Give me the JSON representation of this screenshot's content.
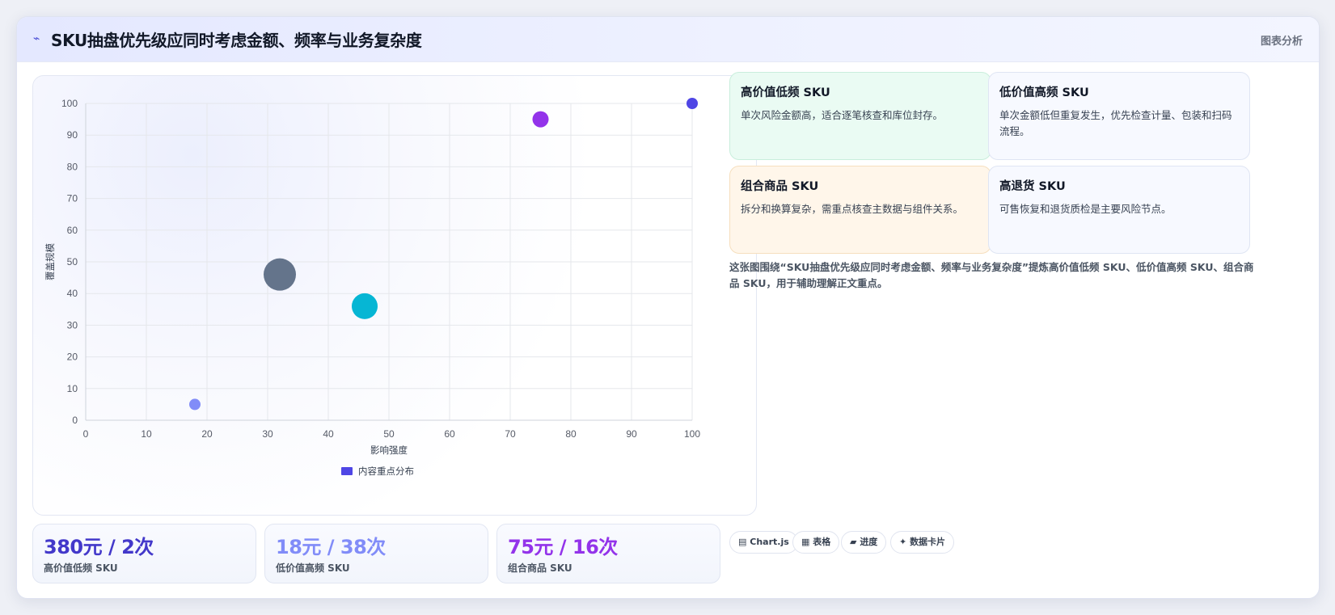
{
  "header": {
    "icon": "chart-icon",
    "title": "SKU抽盘优先级应同时考虑金额、频率与业务复杂度",
    "tag": "图表分析"
  },
  "colors": {
    "accent": "#4f46e5",
    "green_card": "#eafbf3",
    "orange_card": "#fff6ea",
    "blue_card": "#f7f9ff"
  },
  "chart_data": {
    "type": "bubble",
    "xlabel": "影响强度",
    "ylabel": "覆盖规模",
    "xlim": [
      0,
      100
    ],
    "ylim": [
      0,
      100
    ],
    "x_ticks": [
      0,
      10,
      20,
      30,
      40,
      50,
      60,
      70,
      80,
      90,
      100
    ],
    "y_ticks": [
      0,
      10,
      20,
      30,
      40,
      50,
      60,
      70,
      80,
      90,
      100
    ],
    "grid": true,
    "legend": {
      "label": "内容重点分布",
      "color": "#4f46e5",
      "position": "bottom"
    },
    "points": [
      {
        "x": 18,
        "y": 5,
        "r": 7,
        "color": "#818cf8"
      },
      {
        "x": 32,
        "y": 46,
        "r": 20,
        "color": "#64748b"
      },
      {
        "x": 46,
        "y": 36,
        "r": 16,
        "color": "#06b6d4"
      },
      {
        "x": 75,
        "y": 95,
        "r": 10,
        "color": "#9333ea"
      },
      {
        "x": 100,
        "y": 100,
        "r": 7,
        "color": "#4f46e5"
      }
    ]
  },
  "stats": [
    {
      "value": "380元 / 2次",
      "label": "高价值低频 SKU",
      "color": "#4338ca"
    },
    {
      "value": "18元 / 38次",
      "label": "低价值高频 SKU",
      "color": "#818cf8"
    },
    {
      "value": "75元 / 16次",
      "label": "组合商品 SKU",
      "color": "#9333ea"
    }
  ],
  "cards": [
    {
      "title": "高价值低频 SKU",
      "desc": "单次风险金额高，适合逐笔核查和库位封存。"
    },
    {
      "title": "低价值高频 SKU",
      "desc": "单次金额低但重复发生，优先检查计量、包装和扫码流程。"
    },
    {
      "title": "组合商品 SKU",
      "desc": "拆分和换算复杂，需重点核查主数据与组件关系。"
    },
    {
      "title": "高退货 SKU",
      "desc": "可售恢复和退货质检是主要风险节点。"
    }
  ],
  "summary": "这张图围绕“SKU抽盘优先级应同时考虑金额、频率与业务复杂度”提炼高价值低频 SKU、低价值高频 SKU、组合商品 SKU，用于辅助理解正文重点。",
  "chips": [
    {
      "icon": "▤",
      "label": "Chart.js"
    },
    {
      "icon": "▦",
      "label": "表格"
    },
    {
      "icon": "▰",
      "label": "进度"
    },
    {
      "icon": "✦",
      "label": "数据卡片"
    }
  ]
}
